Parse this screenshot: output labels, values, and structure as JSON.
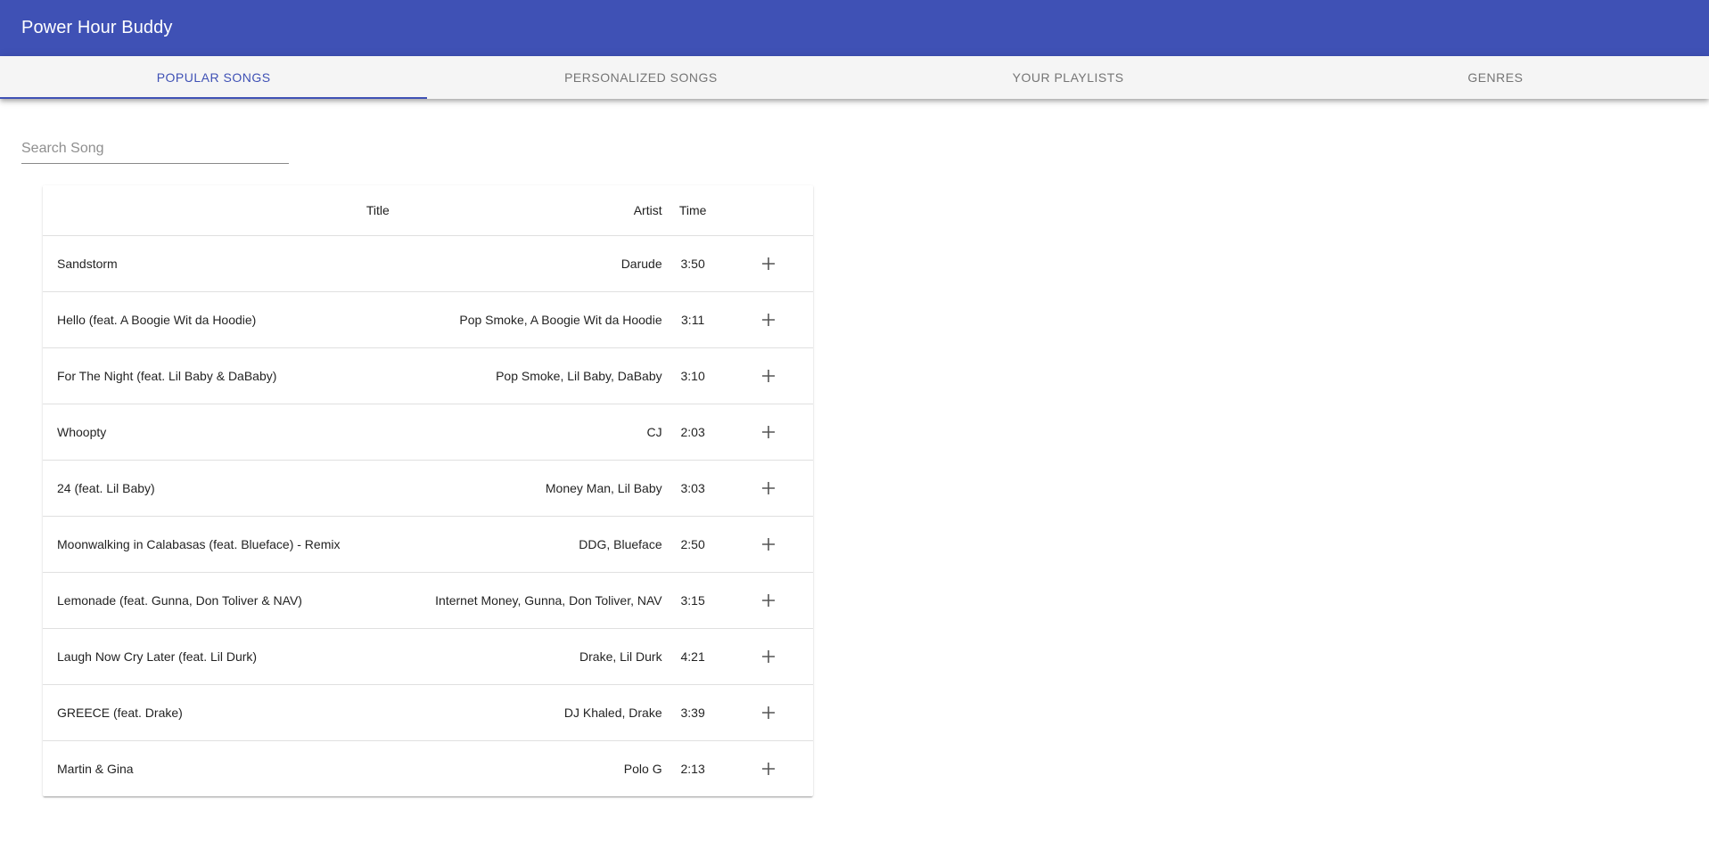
{
  "app": {
    "title": "Power Hour Buddy",
    "accent": "#3f51b5"
  },
  "tabs": [
    {
      "label": "POPULAR SONGS",
      "active": true
    },
    {
      "label": "PERSONALIZED SONGS",
      "active": false
    },
    {
      "label": "YOUR PLAYLISTS",
      "active": false
    },
    {
      "label": "GENRES",
      "active": false
    }
  ],
  "search": {
    "placeholder": "Search Song",
    "value": ""
  },
  "table": {
    "headers": {
      "title": "Title",
      "artist": "Artist",
      "time": "Time"
    },
    "add_icon": "plus-icon",
    "rows": [
      {
        "title": "Sandstorm",
        "artist": "Darude",
        "time": "3:50"
      },
      {
        "title": "Hello (feat. A Boogie Wit da Hoodie)",
        "artist": "Pop Smoke, A Boogie Wit da Hoodie",
        "time": "3:11"
      },
      {
        "title": "For The Night (feat. Lil Baby & DaBaby)",
        "artist": "Pop Smoke, Lil Baby, DaBaby",
        "time": "3:10"
      },
      {
        "title": "Whoopty",
        "artist": "CJ",
        "time": "2:03"
      },
      {
        "title": "24 (feat. Lil Baby)",
        "artist": "Money Man, Lil Baby",
        "time": "3:03"
      },
      {
        "title": "Moonwalking in Calabasas (feat. Blueface) - Remix",
        "artist": "DDG, Blueface",
        "time": "2:50"
      },
      {
        "title": "Lemonade (feat. Gunna, Don Toliver & NAV)",
        "artist": "Internet Money, Gunna, Don Toliver, NAV",
        "time": "3:15"
      },
      {
        "title": "Laugh Now Cry Later (feat. Lil Durk)",
        "artist": "Drake, Lil Durk",
        "time": "4:21"
      },
      {
        "title": "GREECE (feat. Drake)",
        "artist": "DJ Khaled, Drake",
        "time": "3:39"
      },
      {
        "title": "Martin & Gina",
        "artist": "Polo G",
        "time": "2:13"
      }
    ]
  }
}
